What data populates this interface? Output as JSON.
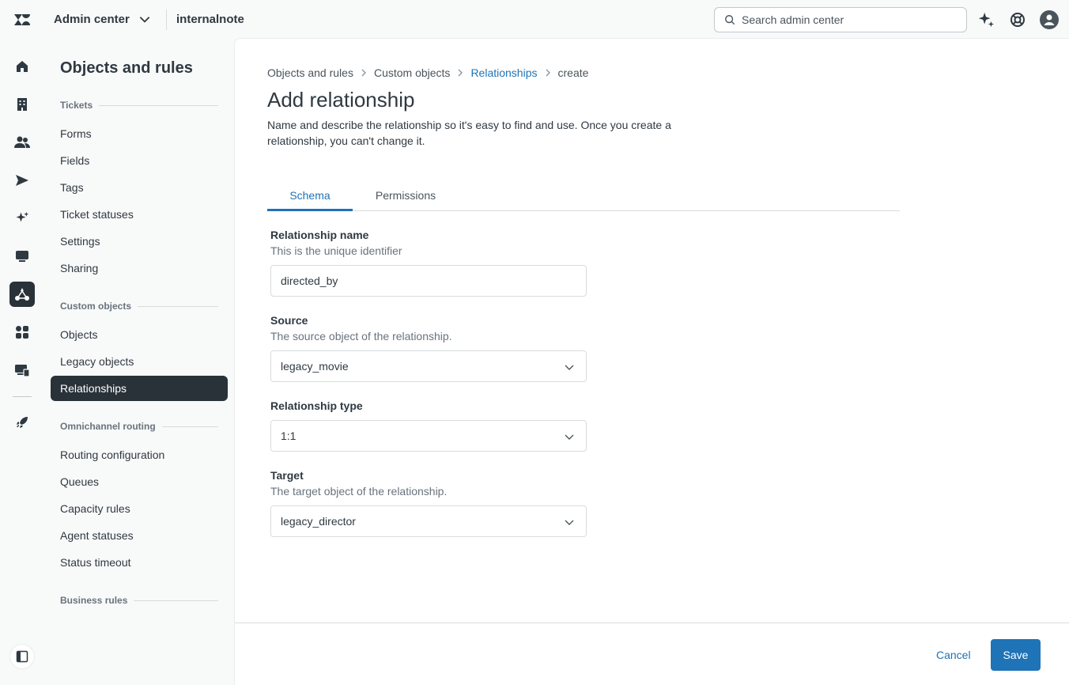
{
  "header": {
    "product_name": "Admin center",
    "instance_name": "internalnote",
    "search_placeholder": "Search admin center"
  },
  "rail": {
    "items": [
      "home-icon",
      "building-icon",
      "people-icon",
      "send-icon",
      "sparkle-icon",
      "chat-icon",
      "objects-and-rules-icon",
      "apps-icon",
      "workspaces-icon",
      "rocket-icon"
    ],
    "active": "objects-and-rules-icon",
    "collapse_icon": "collapse-sidebar-icon"
  },
  "subnav": {
    "title": "Objects and rules",
    "sections": [
      {
        "label": "Tickets",
        "items": [
          "Forms",
          "Fields",
          "Tags",
          "Ticket statuses",
          "Settings",
          "Sharing"
        ]
      },
      {
        "label": "Custom objects",
        "items": [
          "Objects",
          "Legacy objects",
          "Relationships"
        ]
      },
      {
        "label": "Omnichannel routing",
        "items": [
          "Routing configuration",
          "Queues",
          "Capacity rules",
          "Agent statuses",
          "Status timeout"
        ]
      },
      {
        "label": "Business rules",
        "items": []
      }
    ],
    "active_item": "Relationships"
  },
  "breadcrumb": [
    "Objects and rules",
    "Custom objects",
    "Relationships",
    "create"
  ],
  "page": {
    "title": "Add relationship",
    "description": "Name and describe the relationship so it's easy to find and use. Once you create a relationship, you can't change it."
  },
  "tabs": [
    "Schema",
    "Permissions"
  ],
  "active_tab": "Schema",
  "form": {
    "name": {
      "label": "Relationship name",
      "hint": "This is the unique identifier",
      "value": "directed_by"
    },
    "source": {
      "label": "Source",
      "hint": "The source object of the relationship.",
      "value": "legacy_movie"
    },
    "type": {
      "label": "Relationship type",
      "value": "1:1"
    },
    "target": {
      "label": "Target",
      "hint": "The target object of the relationship.",
      "value": "legacy_director"
    }
  },
  "footer": {
    "cancel_label": "Cancel",
    "save_label": "Save"
  },
  "colors": {
    "accent": "#1f73b7",
    "dark": "#293239",
    "text": "#2f3941"
  }
}
